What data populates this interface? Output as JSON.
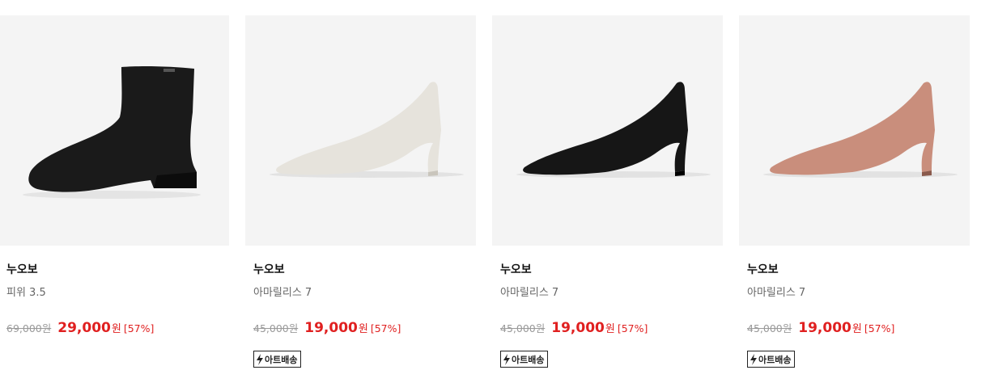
{
  "products": [
    {
      "brand": "누오보",
      "name": "피위 3.5",
      "original_price": "69,000원",
      "sale_price": "29,000",
      "currency": "원",
      "discount": "[57%]",
      "badge": null,
      "shoe_type": "ankle-boot",
      "color": "#1a1a1a",
      "image_icon": "ankle-boot-image"
    },
    {
      "brand": "누오보",
      "name": "아마릴리스 7",
      "original_price": "45,000원",
      "sale_price": "19,000",
      "currency": "원",
      "discount": "[57%]",
      "badge": "아트배송",
      "shoe_type": "pump",
      "color": "#e6e3dc",
      "image_icon": "ivory-pump-image"
    },
    {
      "brand": "누오보",
      "name": "아마릴리스 7",
      "original_price": "45,000원",
      "sale_price": "19,000",
      "currency": "원",
      "discount": "[57%]",
      "badge": "아트배송",
      "shoe_type": "pump",
      "color": "#161616",
      "image_icon": "black-pump-image"
    },
    {
      "brand": "누오보",
      "name": "아마릴리스 7",
      "original_price": "45,000원",
      "sale_price": "19,000",
      "currency": "원",
      "discount": "[57%]",
      "badge": "아트배송",
      "shoe_type": "pump",
      "color": "#c98e7c",
      "image_icon": "pink-pump-image"
    }
  ],
  "colors": {
    "sale": "#e02020",
    "original": "#9a9a9a",
    "thumb_bg": "#f4f4f4"
  }
}
